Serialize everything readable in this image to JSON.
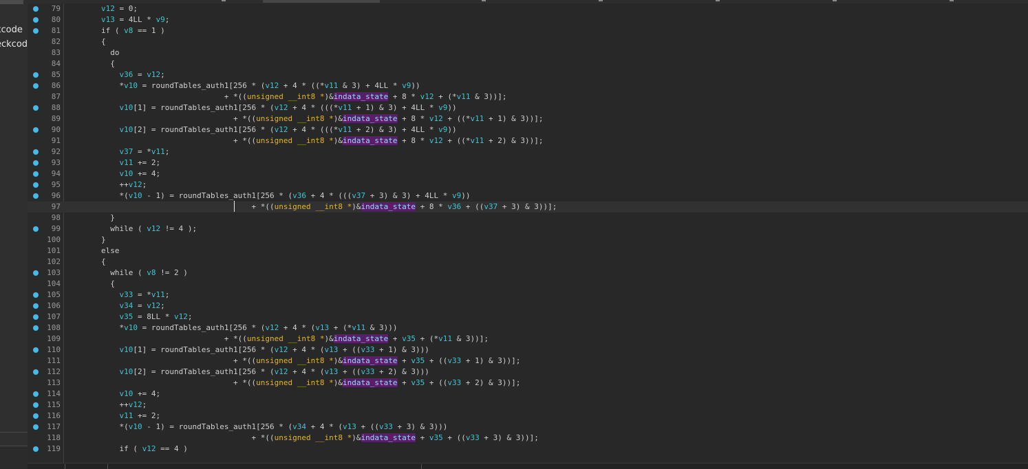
{
  "sidebar": {
    "items": [
      {
        "label": "kcode"
      },
      {
        "label": "eckcod"
      }
    ]
  },
  "editor": {
    "current_line": "97",
    "lines": [
      {
        "n": "79",
        "bp": true,
        "tokens": [
          [
            "i",
            "        "
          ],
          [
            "id",
            "v12"
          ],
          [
            "p",
            " = 0;"
          ]
        ]
      },
      {
        "n": "80",
        "bp": true,
        "tokens": [
          [
            "i",
            "        "
          ],
          [
            "id",
            "v13"
          ],
          [
            "p",
            " = 4LL * "
          ],
          [
            "id",
            "v9"
          ],
          [
            "p",
            ";"
          ]
        ]
      },
      {
        "n": "81",
        "bp": true,
        "tokens": [
          [
            "i",
            "        "
          ],
          [
            "p",
            "if ( "
          ],
          [
            "id",
            "v8"
          ],
          [
            "p",
            " == 1 )"
          ]
        ]
      },
      {
        "n": "82",
        "bp": false,
        "tokens": [
          [
            "i",
            "        "
          ],
          [
            "p",
            "{"
          ]
        ]
      },
      {
        "n": "83",
        "bp": false,
        "tokens": [
          [
            "i",
            "          "
          ],
          [
            "p",
            "do"
          ]
        ]
      },
      {
        "n": "84",
        "bp": false,
        "tokens": [
          [
            "i",
            "          "
          ],
          [
            "p",
            "{"
          ]
        ]
      },
      {
        "n": "85",
        "bp": true,
        "tokens": [
          [
            "i",
            "            "
          ],
          [
            "id",
            "v36"
          ],
          [
            "p",
            " = "
          ],
          [
            "id",
            "v12"
          ],
          [
            "p",
            ";"
          ]
        ]
      },
      {
        "n": "86",
        "bp": true,
        "tokens": [
          [
            "i",
            "            "
          ],
          [
            "p",
            "*"
          ],
          [
            "id",
            "v10"
          ],
          [
            "p",
            " = roundTables_auth1[256 * ("
          ],
          [
            "id",
            "v12"
          ],
          [
            "p",
            " + 4 * ((*"
          ],
          [
            "id",
            "v11"
          ],
          [
            "p",
            " & 3) + 4LL * "
          ],
          [
            "id",
            "v9"
          ],
          [
            "p",
            "))"
          ]
        ]
      },
      {
        "n": "87",
        "bp": false,
        "tokens": [
          [
            "i",
            "                                   "
          ],
          [
            "p",
            "+ *(("
          ],
          [
            "ty",
            "unsigned __int8 *"
          ],
          [
            "p",
            ")&"
          ],
          [
            "hl",
            "indata_state"
          ],
          [
            "p",
            " + 8 * "
          ],
          [
            "id",
            "v12"
          ],
          [
            "p",
            " + (*"
          ],
          [
            "id",
            "v11"
          ],
          [
            "p",
            " & 3))];"
          ]
        ]
      },
      {
        "n": "88",
        "bp": true,
        "tokens": [
          [
            "i",
            "            "
          ],
          [
            "id",
            "v10"
          ],
          [
            "p",
            "[1] = roundTables_auth1[256 * ("
          ],
          [
            "id",
            "v12"
          ],
          [
            "p",
            " + 4 * (((*"
          ],
          [
            "id",
            "v11"
          ],
          [
            "p",
            " + 1) & 3) + 4LL * "
          ],
          [
            "id",
            "v9"
          ],
          [
            "p",
            "))"
          ]
        ]
      },
      {
        "n": "89",
        "bp": false,
        "tokens": [
          [
            "i",
            "                                     "
          ],
          [
            "p",
            "+ *(("
          ],
          [
            "ty",
            "unsigned __int8 *"
          ],
          [
            "p",
            ")&"
          ],
          [
            "hl",
            "indata_state"
          ],
          [
            "p",
            " + 8 * "
          ],
          [
            "id",
            "v12"
          ],
          [
            "p",
            " + ((*"
          ],
          [
            "id",
            "v11"
          ],
          [
            "p",
            " + 1) & 3))];"
          ]
        ]
      },
      {
        "n": "90",
        "bp": true,
        "tokens": [
          [
            "i",
            "            "
          ],
          [
            "id",
            "v10"
          ],
          [
            "p",
            "[2] = roundTables_auth1[256 * ("
          ],
          [
            "id",
            "v12"
          ],
          [
            "p",
            " + 4 * (((*"
          ],
          [
            "id",
            "v11"
          ],
          [
            "p",
            " + 2) & 3) + 4LL * "
          ],
          [
            "id",
            "v9"
          ],
          [
            "p",
            "))"
          ]
        ]
      },
      {
        "n": "91",
        "bp": false,
        "tokens": [
          [
            "i",
            "                                     "
          ],
          [
            "p",
            "+ *(("
          ],
          [
            "ty",
            "unsigned __int8 *"
          ],
          [
            "p",
            ")&"
          ],
          [
            "hl",
            "indata_state"
          ],
          [
            "p",
            " + 8 * "
          ],
          [
            "id",
            "v12"
          ],
          [
            "p",
            " + ((*"
          ],
          [
            "id",
            "v11"
          ],
          [
            "p",
            " + 2) & 3))];"
          ]
        ]
      },
      {
        "n": "92",
        "bp": true,
        "tokens": [
          [
            "i",
            "            "
          ],
          [
            "id",
            "v37"
          ],
          [
            "p",
            " = *"
          ],
          [
            "id",
            "v11"
          ],
          [
            "p",
            ";"
          ]
        ]
      },
      {
        "n": "93",
        "bp": true,
        "tokens": [
          [
            "i",
            "            "
          ],
          [
            "id",
            "v11"
          ],
          [
            "p",
            " += 2;"
          ]
        ]
      },
      {
        "n": "94",
        "bp": true,
        "tokens": [
          [
            "i",
            "            "
          ],
          [
            "id",
            "v10"
          ],
          [
            "p",
            " += 4;"
          ]
        ]
      },
      {
        "n": "95",
        "bp": true,
        "tokens": [
          [
            "i",
            "            "
          ],
          [
            "p",
            "++"
          ],
          [
            "id",
            "v12"
          ],
          [
            "p",
            ";"
          ]
        ]
      },
      {
        "n": "96",
        "bp": true,
        "tokens": [
          [
            "i",
            "            "
          ],
          [
            "p",
            "*("
          ],
          [
            "id",
            "v10"
          ],
          [
            "p",
            " - 1) = roundTables_auth1[256 * ("
          ],
          [
            "id",
            "v36"
          ],
          [
            "p",
            " + 4 * ((("
          ],
          [
            "id",
            "v37"
          ],
          [
            "p",
            " + 3) & 3) + 4LL * "
          ],
          [
            "id",
            "v9"
          ],
          [
            "p",
            "))"
          ]
        ]
      },
      {
        "n": "97",
        "bp": false,
        "tokens": [
          [
            "i",
            "                                         "
          ],
          [
            "p",
            "+ *(("
          ],
          [
            "ty",
            "unsigned __int8 *"
          ],
          [
            "p",
            ")&"
          ],
          [
            "hl",
            "indata_state"
          ],
          [
            "p",
            " + 8 * "
          ],
          [
            "id",
            "v36"
          ],
          [
            "p",
            " + (("
          ],
          [
            "id",
            "v37"
          ],
          [
            "p",
            " + 3) & 3))];"
          ]
        ]
      },
      {
        "n": "98",
        "bp": false,
        "tokens": [
          [
            "i",
            "          "
          ],
          [
            "p",
            "}"
          ]
        ]
      },
      {
        "n": "99",
        "bp": true,
        "tokens": [
          [
            "i",
            "          "
          ],
          [
            "p",
            "while ( "
          ],
          [
            "id",
            "v12"
          ],
          [
            "p",
            " != 4 );"
          ]
        ]
      },
      {
        "n": "100",
        "bp": false,
        "tokens": [
          [
            "i",
            "        "
          ],
          [
            "p",
            "}"
          ]
        ]
      },
      {
        "n": "101",
        "bp": false,
        "tokens": [
          [
            "i",
            "        "
          ],
          [
            "p",
            "else"
          ]
        ]
      },
      {
        "n": "102",
        "bp": false,
        "tokens": [
          [
            "i",
            "        "
          ],
          [
            "p",
            "{"
          ]
        ]
      },
      {
        "n": "103",
        "bp": true,
        "tokens": [
          [
            "i",
            "          "
          ],
          [
            "p",
            "while ( "
          ],
          [
            "id",
            "v8"
          ],
          [
            "p",
            " != 2 )"
          ]
        ]
      },
      {
        "n": "104",
        "bp": false,
        "tokens": [
          [
            "i",
            "          "
          ],
          [
            "p",
            "{"
          ]
        ]
      },
      {
        "n": "105",
        "bp": true,
        "tokens": [
          [
            "i",
            "            "
          ],
          [
            "id",
            "v33"
          ],
          [
            "p",
            " = *"
          ],
          [
            "id",
            "v11"
          ],
          [
            "p",
            ";"
          ]
        ]
      },
      {
        "n": "106",
        "bp": true,
        "tokens": [
          [
            "i",
            "            "
          ],
          [
            "id",
            "v34"
          ],
          [
            "p",
            " = "
          ],
          [
            "id",
            "v12"
          ],
          [
            "p",
            ";"
          ]
        ]
      },
      {
        "n": "107",
        "bp": true,
        "tokens": [
          [
            "i",
            "            "
          ],
          [
            "id",
            "v35"
          ],
          [
            "p",
            " = 8LL * "
          ],
          [
            "id",
            "v12"
          ],
          [
            "p",
            ";"
          ]
        ]
      },
      {
        "n": "108",
        "bp": true,
        "tokens": [
          [
            "i",
            "            "
          ],
          [
            "p",
            "*"
          ],
          [
            "id",
            "v10"
          ],
          [
            "p",
            " = roundTables_auth1[256 * ("
          ],
          [
            "id",
            "v12"
          ],
          [
            "p",
            " + 4 * ("
          ],
          [
            "id",
            "v13"
          ],
          [
            "p",
            " + (*"
          ],
          [
            "id",
            "v11"
          ],
          [
            "p",
            " & 3)))"
          ]
        ]
      },
      {
        "n": "109",
        "bp": false,
        "tokens": [
          [
            "i",
            "                                   "
          ],
          [
            "p",
            "+ *(("
          ],
          [
            "ty",
            "unsigned __int8 *"
          ],
          [
            "p",
            ")&"
          ],
          [
            "hl",
            "indata_state"
          ],
          [
            "p",
            " + "
          ],
          [
            "id",
            "v35"
          ],
          [
            "p",
            " + (*"
          ],
          [
            "id",
            "v11"
          ],
          [
            "p",
            " & 3))];"
          ]
        ]
      },
      {
        "n": "110",
        "bp": true,
        "tokens": [
          [
            "i",
            "            "
          ],
          [
            "id",
            "v10"
          ],
          [
            "p",
            "[1] = roundTables_auth1[256 * ("
          ],
          [
            "id",
            "v12"
          ],
          [
            "p",
            " + 4 * ("
          ],
          [
            "id",
            "v13"
          ],
          [
            "p",
            " + (("
          ],
          [
            "id",
            "v33"
          ],
          [
            "p",
            " + 1) & 3)))"
          ]
        ]
      },
      {
        "n": "111",
        "bp": false,
        "tokens": [
          [
            "i",
            "                                     "
          ],
          [
            "p",
            "+ *(("
          ],
          [
            "ty",
            "unsigned __int8 *"
          ],
          [
            "p",
            ")&"
          ],
          [
            "hl",
            "indata_state"
          ],
          [
            "p",
            " + "
          ],
          [
            "id",
            "v35"
          ],
          [
            "p",
            " + (("
          ],
          [
            "id",
            "v33"
          ],
          [
            "p",
            " + 1) & 3))];"
          ]
        ]
      },
      {
        "n": "112",
        "bp": true,
        "tokens": [
          [
            "i",
            "            "
          ],
          [
            "id",
            "v10"
          ],
          [
            "p",
            "[2] = roundTables_auth1[256 * ("
          ],
          [
            "id",
            "v12"
          ],
          [
            "p",
            " + 4 * ("
          ],
          [
            "id",
            "v13"
          ],
          [
            "p",
            " + (("
          ],
          [
            "id",
            "v33"
          ],
          [
            "p",
            " + 2) & 3)))"
          ]
        ]
      },
      {
        "n": "113",
        "bp": false,
        "tokens": [
          [
            "i",
            "                                     "
          ],
          [
            "p",
            "+ *(("
          ],
          [
            "ty",
            "unsigned __int8 *"
          ],
          [
            "p",
            ")&"
          ],
          [
            "hl",
            "indata_state"
          ],
          [
            "p",
            " + "
          ],
          [
            "id",
            "v35"
          ],
          [
            "p",
            " + (("
          ],
          [
            "id",
            "v33"
          ],
          [
            "p",
            " + 2) & 3))];"
          ]
        ]
      },
      {
        "n": "114",
        "bp": true,
        "tokens": [
          [
            "i",
            "            "
          ],
          [
            "id",
            "v10"
          ],
          [
            "p",
            " += 4;"
          ]
        ]
      },
      {
        "n": "115",
        "bp": true,
        "tokens": [
          [
            "i",
            "            "
          ],
          [
            "p",
            "++"
          ],
          [
            "id",
            "v12"
          ],
          [
            "p",
            ";"
          ]
        ]
      },
      {
        "n": "116",
        "bp": true,
        "tokens": [
          [
            "i",
            "            "
          ],
          [
            "id",
            "v11"
          ],
          [
            "p",
            " += 2;"
          ]
        ]
      },
      {
        "n": "117",
        "bp": true,
        "tokens": [
          [
            "i",
            "            "
          ],
          [
            "p",
            "*("
          ],
          [
            "id",
            "v10"
          ],
          [
            "p",
            " - 1) = roundTables_auth1[256 * ("
          ],
          [
            "id",
            "v34"
          ],
          [
            "p",
            " + 4 * ("
          ],
          [
            "id",
            "v13"
          ],
          [
            "p",
            " + (("
          ],
          [
            "id",
            "v33"
          ],
          [
            "p",
            " + 3) & 3)))"
          ]
        ]
      },
      {
        "n": "118",
        "bp": false,
        "tokens": [
          [
            "i",
            "                                         "
          ],
          [
            "p",
            "+ *(("
          ],
          [
            "ty",
            "unsigned __int8 *"
          ],
          [
            "p",
            ")&"
          ],
          [
            "hl",
            "indata_state"
          ],
          [
            "p",
            " + "
          ],
          [
            "id",
            "v35"
          ],
          [
            "p",
            " + (("
          ],
          [
            "id",
            "v33"
          ],
          [
            "p",
            " + 3) & 3))];"
          ]
        ]
      },
      {
        "n": "119",
        "bp": true,
        "tokens": [
          [
            "i",
            "            "
          ],
          [
            "p",
            "if ( "
          ],
          [
            "id",
            "v12"
          ],
          [
            "p",
            " == 4 )"
          ]
        ]
      }
    ]
  },
  "colors": {
    "background": "#282828",
    "identifier": "#3ec7d3",
    "type": "#e6b422",
    "highlight_bg": "#5b1d6b",
    "breakpoint": "#47b8ec"
  }
}
